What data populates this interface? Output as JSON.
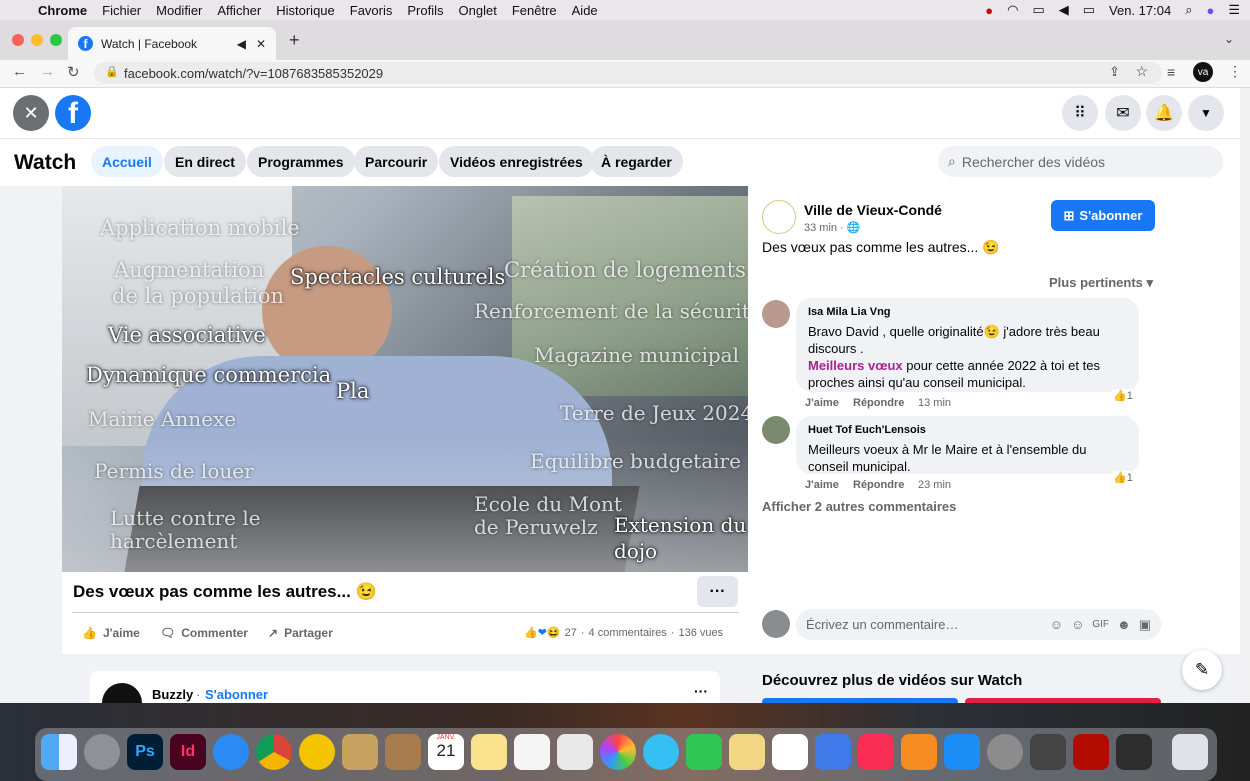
{
  "menubar": {
    "app": "Chrome",
    "items": [
      "Fichier",
      "Modifier",
      "Afficher",
      "Historique",
      "Favoris",
      "Profils",
      "Onglet",
      "Fenêtre",
      "Aide"
    ],
    "clock": "Ven. 17:04"
  },
  "browser": {
    "tab_title": "Watch | Facebook",
    "url": "facebook.com/watch/?v=1087683585352029",
    "profile_initials": "va"
  },
  "watch": {
    "title": "Watch",
    "nav": [
      "Accueil",
      "En direct",
      "Programmes",
      "Parcourir",
      "Vidéos enregistrées",
      "À regarder"
    ],
    "search_placeholder": "Rechercher des vidéos"
  },
  "video_overlay": [
    "Application mobile",
    "Augmentation",
    "de la population",
    "Spectacles culturels",
    "Création de logements",
    "Renforcement de la sécurité",
    "Vie associative",
    "Magazine municipal",
    "Dynamique commercia",
    "Pla",
    "Mairie Annexe",
    "Terre de Jeux 2024",
    "Permis de louer",
    "Equilibre budgetaire",
    "Lutte contre le",
    "harcèlement",
    "Ecole du Mont",
    "de Peruwelz",
    "Extension du",
    "dojo"
  ],
  "post": {
    "title": "Des vœux pas comme les autres...",
    "emoji": "😉",
    "like": "J'aime",
    "comment": "Commenter",
    "share": "Partager",
    "reaction_count": "27",
    "comments": "4 commentaires",
    "views": "136 vues",
    "more": "···"
  },
  "page_info": {
    "name": "Ville de Vieux-Condé",
    "time": "33 min",
    "subscribe": "S'abonner",
    "caption": "Des vœux pas comme les autres... 😉",
    "sort": "Plus pertinents"
  },
  "comments": [
    {
      "author": "Isa Mila Lia Vng",
      "text_a": "Bravo David , quelle originalité😉 j'adore très beau discours .",
      "highlight": "Meilleurs vœux",
      "text_b": " pour cette année 2022 à toi et tes proches ainsi qu'au conseil municipal.",
      "like": "J'aime",
      "reply": "Répondre",
      "time": "13 min",
      "reactions": "1"
    },
    {
      "author": "Huet Tof Euch'Lensois",
      "text_a": "Meilleurs voeux à Mr le Maire et à l'ensemble du conseil municipal.",
      "like": "J'aime",
      "reply": "Répondre",
      "time": "23 min",
      "reactions": "1"
    }
  ],
  "more_comments": "Afficher 2 autres commentaires",
  "comment_placeholder": "Écrivez un commentaire…",
  "discover": "Découvrez plus de vidéos sur Watch",
  "next_post": {
    "name": "Buzzly",
    "subscribe": "S'abonner",
    "more": "···"
  },
  "calendar": {
    "month": "JANV.",
    "day": "21"
  }
}
